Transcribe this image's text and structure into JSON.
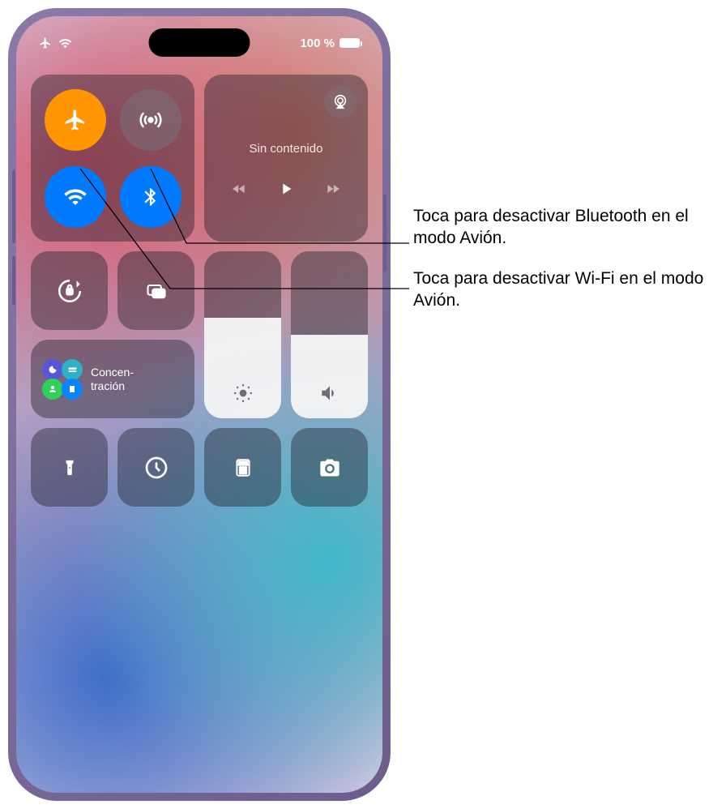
{
  "status": {
    "battery_text": "100 %",
    "battery_level": 100
  },
  "connectivity": {
    "airplane": {
      "active": true,
      "color": "#ff9500"
    },
    "cellular": {
      "active": false
    },
    "wifi": {
      "active": true,
      "color": "#007aff"
    },
    "bluetooth": {
      "active": true,
      "color": "#007aff"
    }
  },
  "media": {
    "title": "Sin contenido"
  },
  "focus": {
    "label": "Concen-\ntración"
  },
  "sliders": {
    "brightness_pct": 60,
    "volume_pct": 50
  },
  "callouts": {
    "bluetooth": "Toca para desactivar Bluetooth en el modo Avión.",
    "wifi": "Toca para desactivar Wi-Fi en el modo Avión."
  },
  "icons": {
    "airplane": "airplane-icon",
    "cellular": "cellular-antenna-icon",
    "wifi": "wifi-icon",
    "bluetooth": "bluetooth-icon",
    "airplay": "airplay-icon",
    "prev": "previous-track-icon",
    "play": "play-icon",
    "next": "next-track-icon",
    "orientation_lock": "orientation-lock-icon",
    "screen_mirroring": "screen-mirroring-icon",
    "brightness": "brightness-icon",
    "volume": "volume-icon",
    "flashlight": "flashlight-icon",
    "timer": "timer-icon",
    "calculator": "calculator-icon",
    "camera": "camera-icon",
    "moon": "moon-icon",
    "bed": "bed-icon",
    "person": "person-icon",
    "car": "car-icon"
  }
}
